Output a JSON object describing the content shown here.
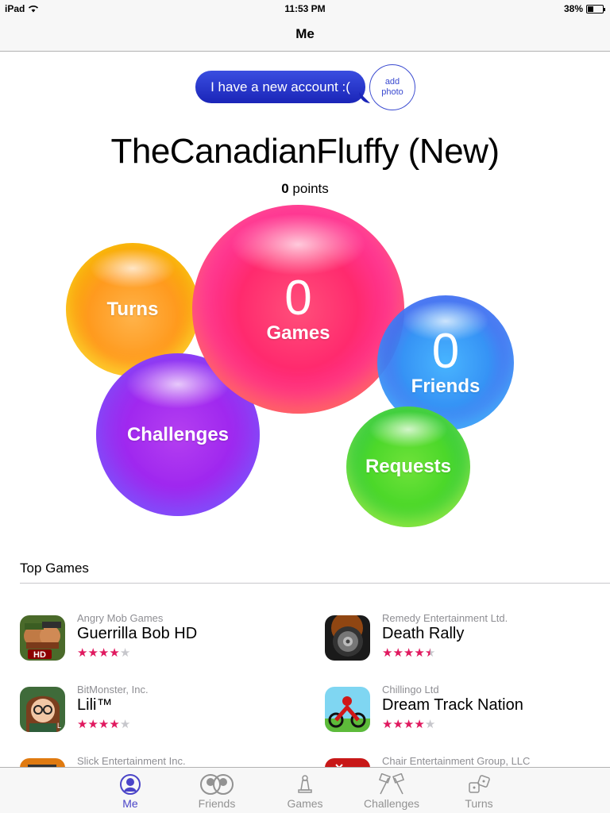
{
  "status": {
    "device": "iPad",
    "time": "11:53 PM",
    "battery": "38%",
    "battery_level": 0.38
  },
  "nav": {
    "title": "Me"
  },
  "profile": {
    "status_message": "I have a new account :(",
    "add_photo_line1": "add",
    "add_photo_line2": "photo",
    "username": "TheCanadianFluffy (New)",
    "points_value": "0",
    "points_label": "points"
  },
  "bubbles": {
    "turns": {
      "label": "Turns"
    },
    "games": {
      "count": "0",
      "label": "Games"
    },
    "friends": {
      "count": "0",
      "label": "Friends"
    },
    "challenges": {
      "label": "Challenges"
    },
    "requests": {
      "label": "Requests"
    }
  },
  "top_games": {
    "title": "Top Games",
    "items": [
      {
        "developer": "Angry Mob Games",
        "name": "Guerrilla Bob HD",
        "rating": 4,
        "icon": "guerrilla-bob-icon"
      },
      {
        "developer": "Remedy Entertainment Ltd.",
        "name": "Death Rally",
        "rating": 4.5,
        "icon": "death-rally-icon"
      },
      {
        "developer": "BitMonster, Inc.",
        "name": "Lili™",
        "rating": 4,
        "icon": "lili-icon"
      },
      {
        "developer": "Chillingo Ltd",
        "name": "Dream Track Nation",
        "rating": 4,
        "icon": "dream-track-nation-icon"
      },
      {
        "developer": "Slick Entertainment Inc.",
        "name": "",
        "rating": null,
        "icon": "slick-game-icon"
      },
      {
        "developer": "Chair Entertainment Group, LLC",
        "name": "",
        "rating": null,
        "icon": "chair-game-icon"
      }
    ]
  },
  "tabs": [
    {
      "label": "Me",
      "icon": "me-icon",
      "active": true
    },
    {
      "label": "Friends",
      "icon": "friends-icon",
      "active": false
    },
    {
      "label": "Games",
      "icon": "games-icon",
      "active": false
    },
    {
      "label": "Challenges",
      "icon": "challenges-icon",
      "active": false
    },
    {
      "label": "Turns",
      "icon": "turns-icon",
      "active": false
    }
  ],
  "colors": {
    "accent": "#4a44c8",
    "star": "#e0195f",
    "bubble": "#1a25b8"
  }
}
